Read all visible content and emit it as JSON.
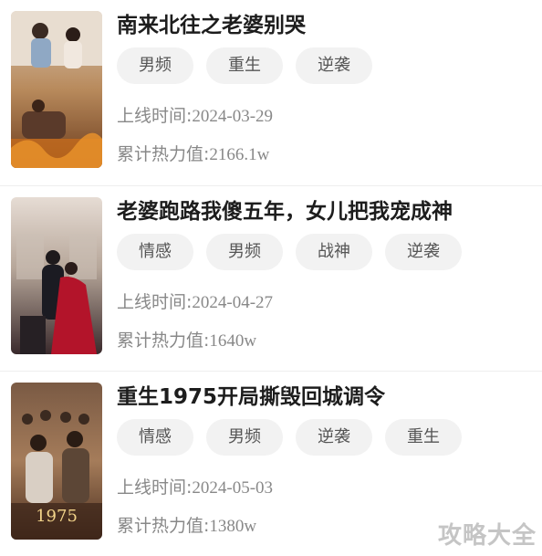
{
  "dramas": [
    {
      "title": "南来北往之老婆别哭",
      "tags": [
        "男频",
        "重生",
        "逆袭"
      ],
      "online_label": "上线时间:",
      "online_date": "2024-03-29",
      "heat_label": "累计热力值:",
      "heat_value": "2166.1w",
      "cover_text": "南来北往之老婆别哭"
    },
    {
      "title": "老婆跑路我傻五年，女儿把我宠成神",
      "tags": [
        "情感",
        "男频",
        "战神",
        "逆袭"
      ],
      "online_label": "上线时间:",
      "online_date": "2024-04-27",
      "heat_label": "累计热力值:",
      "heat_value": "1640w",
      "cover_text": "老婆跑路我傻五年女儿把我宠成神"
    },
    {
      "title": "重生1975开局撕毁回城调令",
      "tags": [
        "情感",
        "男频",
        "逆袭",
        "重生"
      ],
      "online_label": "上线时间:",
      "online_date": "2024-05-03",
      "heat_label": "累计热力值:",
      "heat_value": "1380w",
      "cover_text": "重生1975"
    }
  ],
  "watermark": "攻略大全"
}
